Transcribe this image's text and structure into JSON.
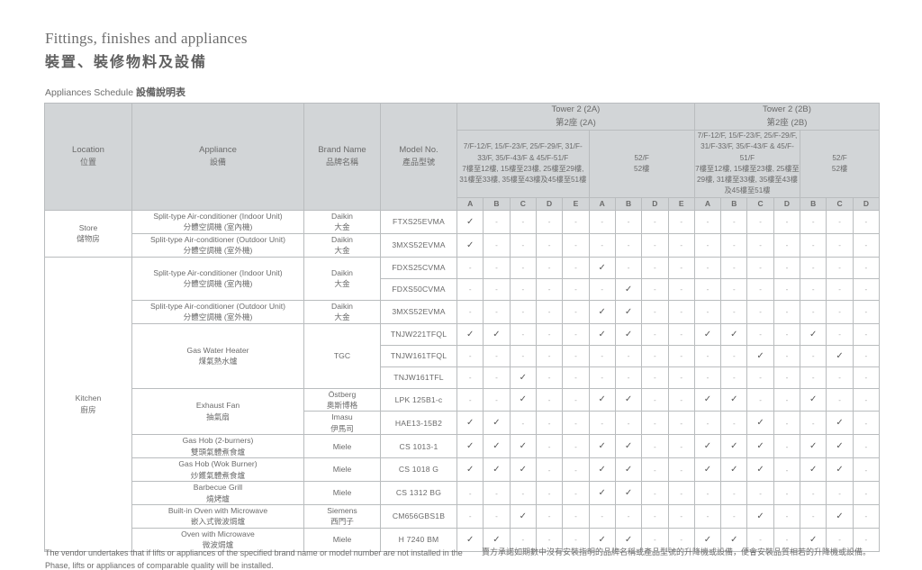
{
  "heading": {
    "title_en": "Fittings, finishes and appliances",
    "title_zh": "裝置、裝修物料及設備",
    "subtitle_en": "Appliances Schedule ",
    "subtitle_zh": "設備說明表"
  },
  "table": {
    "columns": {
      "location_en": "Location",
      "location_zh": "位置",
      "appliance_en": "Appliance",
      "appliance_zh": "設備",
      "brand_en": "Brand Name",
      "brand_zh": "品牌名稱",
      "model_en": "Model No.",
      "model_zh": "產品型號"
    },
    "towers": [
      {
        "en": "Tower 2 (2A)",
        "zh": "第2座 (2A)"
      },
      {
        "en": "Tower 2 (2B)",
        "zh": "第2座 (2B)"
      }
    ],
    "floor_groups": [
      {
        "en": "7/F-12/F, 15/F-23/F, 25/F-29/F, 31/F-33/F, 35/F-43/F & 45/F-51/F",
        "zh": "7樓至12樓, 15樓至23樓, 25樓至29樓, 31樓至33樓, 35樓至43樓及45樓至51樓",
        "units": [
          "A",
          "B",
          "C",
          "D",
          "E"
        ]
      },
      {
        "en": "52/F",
        "zh": "52樓",
        "units": [
          "A",
          "B",
          "D",
          "E"
        ]
      },
      {
        "en": "7/F-12/F, 15/F-23/F, 25/F-29/F, 31/F-33/F, 35/F-43/F & 45/F-51/F",
        "zh": "7樓至12樓, 15樓至23樓, 25樓至29樓, 31樓至33樓, 35樓至43樓及45樓至51樓",
        "units": [
          "A",
          "B",
          "C",
          "D"
        ]
      },
      {
        "en": "52/F",
        "zh": "52樓",
        "units": [
          "B",
          "C",
          "D"
        ]
      }
    ],
    "locations": [
      {
        "en": "Store",
        "zh": "儲物房"
      },
      {
        "en": "Kitchen",
        "zh": "廚房"
      }
    ],
    "check_symbol": "✓",
    "dash_symbol": "-",
    "rows": [
      {
        "location_index": 0,
        "appliance_en": "Split-type Air-conditioner (Indoor Unit)",
        "appliance_zh": "分體空調機 (室內機)",
        "brand_en": "Daikin",
        "brand_zh": "大金",
        "model": "FTXS25EVMA",
        "marks": [
          1,
          0,
          0,
          0,
          0,
          0,
          0,
          0,
          0,
          0,
          0,
          0,
          0,
          0,
          0,
          0
        ]
      },
      {
        "location_index": 0,
        "appliance_en": "Split-type Air-conditioner (Outdoor Unit)",
        "appliance_zh": "分體空調機 (室外機)",
        "brand_en": "Daikin",
        "brand_zh": "大金",
        "model": "3MXS52EVMA",
        "marks": [
          1,
          0,
          0,
          0,
          0,
          0,
          0,
          0,
          0,
          0,
          0,
          0,
          0,
          0,
          0,
          0
        ]
      },
      {
        "location_index": 1,
        "appliance_en": "Split-type Air-conditioner (Indoor Unit)",
        "appliance_zh": "分體空調機 (室內機)",
        "brand_en": "Daikin",
        "brand_zh": "大金",
        "model": "FDXS25CVMA",
        "marks": [
          0,
          0,
          0,
          0,
          0,
          1,
          0,
          0,
          0,
          0,
          0,
          0,
          0,
          0,
          0,
          0
        ]
      },
      {
        "location_index": 1,
        "appliance_en": "",
        "appliance_zh": "",
        "brand_en": "",
        "brand_zh": "",
        "model": "FDXS50CVMA",
        "marks": [
          0,
          0,
          0,
          0,
          0,
          0,
          1,
          0,
          0,
          0,
          0,
          0,
          0,
          0,
          0,
          0
        ]
      },
      {
        "location_index": 1,
        "appliance_en": "Split-type Air-conditioner (Outdoor Unit)",
        "appliance_zh": "分體空調機 (室外機)",
        "brand_en": "Daikin",
        "brand_zh": "大金",
        "model": "3MXS52EVMA",
        "marks": [
          0,
          0,
          0,
          0,
          0,
          1,
          1,
          0,
          0,
          0,
          0,
          0,
          0,
          0,
          0,
          0
        ]
      },
      {
        "location_index": 1,
        "appliance_en": "Gas Water Heater",
        "appliance_zh": "煤氣熱水爐",
        "brand_en": "TGC",
        "brand_zh": "",
        "model": "TNJW221TFQL",
        "marks": [
          1,
          1,
          0,
          0,
          0,
          1,
          1,
          0,
          0,
          1,
          1,
          0,
          0,
          1,
          0,
          0
        ]
      },
      {
        "location_index": 1,
        "appliance_en": "",
        "appliance_zh": "",
        "brand_en": "",
        "brand_zh": "",
        "model": "TNJW161TFQL",
        "marks": [
          0,
          0,
          0,
          0,
          0,
          0,
          0,
          0,
          0,
          0,
          0,
          1,
          0,
          0,
          1,
          0
        ]
      },
      {
        "location_index": 1,
        "appliance_en": "",
        "appliance_zh": "",
        "brand_en": "",
        "brand_zh": "",
        "model": "TNJW161TFL",
        "marks": [
          0,
          0,
          1,
          0,
          0,
          0,
          0,
          0,
          0,
          0,
          0,
          0,
          0,
          0,
          0,
          0
        ]
      },
      {
        "location_index": 1,
        "appliance_en": "Exhaust Fan",
        "appliance_zh": "抽氣扇",
        "brand_en": "Östberg",
        "brand_zh": "奧斯博格",
        "model": "LPK 125B1-c",
        "marks": [
          0,
          0,
          1,
          0,
          0,
          1,
          1,
          0,
          0,
          1,
          1,
          0,
          0,
          1,
          0,
          0
        ]
      },
      {
        "location_index": 1,
        "appliance_en": "",
        "appliance_zh": "",
        "brand_en": "Imasu",
        "brand_zh": "伊馬司",
        "model": "HAE13-15B2",
        "marks": [
          1,
          1,
          0,
          0,
          0,
          0,
          0,
          0,
          0,
          0,
          0,
          1,
          0,
          0,
          1,
          0
        ]
      },
      {
        "location_index": 1,
        "appliance_en": "Gas Hob (2-burners)",
        "appliance_zh": "雙頭氣體煮食爐",
        "brand_en": "Miele",
        "brand_zh": "",
        "model": "CS 1013-1",
        "marks": [
          1,
          1,
          1,
          0,
          0,
          1,
          1,
          0,
          0,
          1,
          1,
          1,
          0,
          1,
          1,
          0
        ]
      },
      {
        "location_index": 1,
        "appliance_en": "Gas Hob (Wok Burner)",
        "appliance_zh": "炒鑊氣體煮食爐",
        "brand_en": "Miele",
        "brand_zh": "",
        "model": "CS 1018 G",
        "marks": [
          1,
          1,
          1,
          0,
          0,
          1,
          1,
          0,
          0,
          1,
          1,
          1,
          0,
          1,
          1,
          0
        ]
      },
      {
        "location_index": 1,
        "appliance_en": "Barbecue Grill",
        "appliance_zh": "燒烤爐",
        "brand_en": "Miele",
        "brand_zh": "",
        "model": "CS 1312 BG",
        "marks": [
          0,
          0,
          0,
          0,
          0,
          1,
          1,
          0,
          0,
          0,
          0,
          0,
          0,
          0,
          0,
          0
        ]
      },
      {
        "location_index": 1,
        "appliance_en": "Built-in Oven with Microwave",
        "appliance_zh": "嵌入式微波焗爐",
        "brand_en": "Siemens",
        "brand_zh": "西門子",
        "model": "CM656GBS1B",
        "marks": [
          0,
          0,
          1,
          0,
          0,
          0,
          0,
          0,
          0,
          0,
          0,
          1,
          0,
          0,
          1,
          0
        ]
      },
      {
        "location_index": 1,
        "appliance_en": "Oven with Microwave",
        "appliance_zh": "微波焗爐",
        "brand_en": "Miele",
        "brand_zh": "",
        "model": "H 7240 BM",
        "marks": [
          1,
          1,
          0,
          0,
          0,
          1,
          1,
          0,
          0,
          1,
          1,
          0,
          0,
          1,
          0,
          0
        ]
      }
    ]
  },
  "footer": {
    "en": "The vendor undertakes that if lifts or appliances of the specified brand name or model number are not installed in the Phase, lifts or appliances of comparable quality will be installed.",
    "zh": "賣方承諾如期數中沒有安裝指明的品牌名稱或產品型號的升降機或設備，便會安裝品質相若的升降機或設備。"
  }
}
